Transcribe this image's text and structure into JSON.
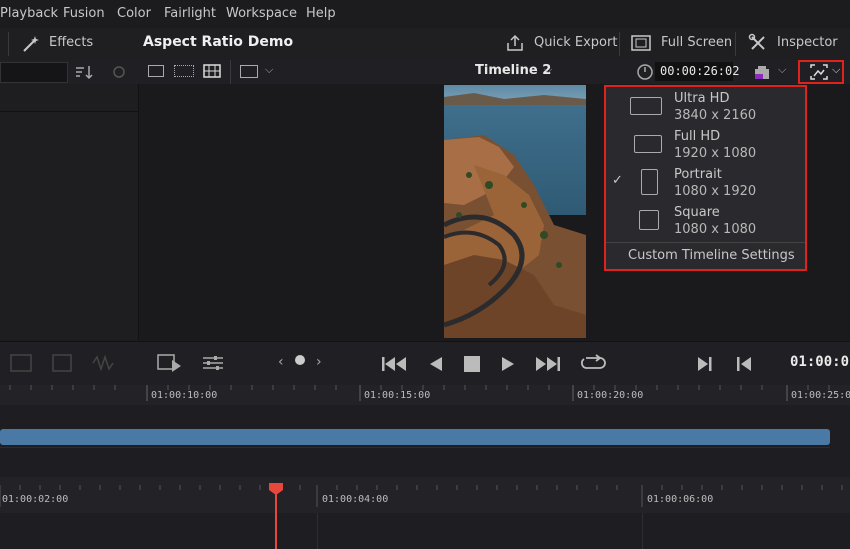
{
  "menubar": {
    "items": [
      "Playback",
      "Fusion",
      "Color",
      "Fairlight",
      "Workspace",
      "Help"
    ]
  },
  "toolbar": {
    "effects_label": "Effects",
    "project_title": "Aspect Ratio Demo",
    "quick_export_label": "Quick Export",
    "full_screen_label": "Full Screen",
    "inspector_label": "Inspector"
  },
  "viewer_bar": {
    "timeline_name": "Timeline 2",
    "timecode": "00:00:26:02"
  },
  "dropdown": {
    "options": [
      {
        "name": "Ultra HD",
        "dims": "3840 x 2160",
        "checked": false
      },
      {
        "name": "Full HD",
        "dims": "1920 x 1080",
        "checked": false
      },
      {
        "name": "Portrait",
        "dims": "1080 x 1920",
        "checked": true
      },
      {
        "name": "Square",
        "dims": "1080 x 1080",
        "checked": false
      }
    ],
    "custom_label": "Custom Timeline Settings",
    "checkmark": "✓"
  },
  "transport": {
    "timecode": "01:00:0"
  },
  "ruler_top": {
    "labels": [
      "01:00:10:00",
      "01:00:15:00",
      "01:00:20:00",
      "01:00:25:0"
    ]
  },
  "ruler_bottom": {
    "labels": [
      "01:00:02:00",
      "01:00:04:00",
      "01:00:06:00"
    ]
  },
  "colors": {
    "accent_red": "#e0221f",
    "clip_blue": "#4a79a6",
    "playhead": "#e8473c"
  }
}
